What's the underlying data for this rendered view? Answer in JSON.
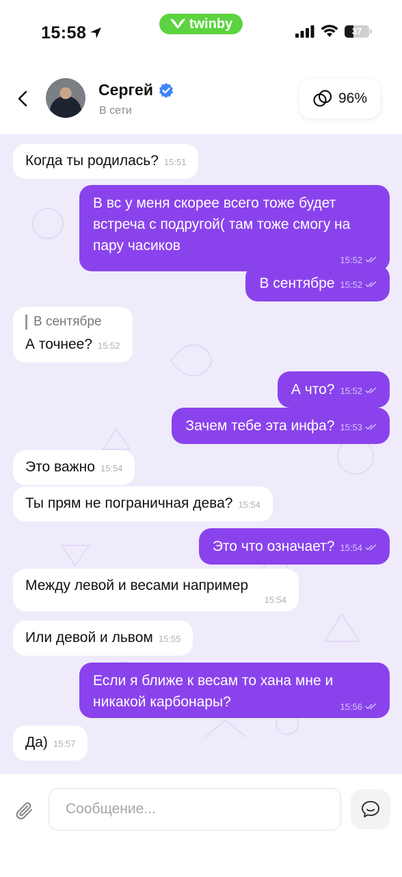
{
  "status_bar": {
    "time": "15:58",
    "brand": "twinby",
    "battery": "37"
  },
  "header": {
    "name": "Сергей",
    "presence": "В сети",
    "match_percent": "96%"
  },
  "messages": [
    {
      "side": "in",
      "text": "Когда ты родилась?",
      "time": "15:51"
    },
    {
      "side": "out",
      "text": "В вс у меня скорее всего тоже будет встреча с подругой( там тоже смогу на пару часиков",
      "time": "15:52"
    },
    {
      "side": "out",
      "text": "В сентябре",
      "time": "15:52"
    },
    {
      "side": "in",
      "reply_to": "В сентябре",
      "text": "А точнее?",
      "time": "15:52"
    },
    {
      "side": "out",
      "text": "А что?",
      "time": "15:52"
    },
    {
      "side": "out",
      "text": "Зачем тебе эта инфа?",
      "time": "15:53"
    },
    {
      "side": "in",
      "text": "Это важно",
      "time": "15:54"
    },
    {
      "side": "in",
      "text": "Ты прям не пограничная дева?",
      "time": "15:54"
    },
    {
      "side": "out",
      "text": "Это что означает?",
      "time": "15:54"
    },
    {
      "side": "in",
      "text": "Между левой и весами например",
      "time": "15:54"
    },
    {
      "side": "in",
      "text": "Или девой и львом",
      "time": "15:55"
    },
    {
      "side": "out",
      "text": "Если я ближе к весам то хана мне и никакой карбонары?",
      "time": "15:56"
    },
    {
      "side": "in",
      "text": "Да)",
      "time": "15:57"
    }
  ],
  "input": {
    "placeholder": "Сообщение..."
  },
  "colors": {
    "accent": "#8a43ec",
    "chat_bg": "#efebfb",
    "brand_green": "#5cd33f",
    "verified": "#3d86f6"
  }
}
